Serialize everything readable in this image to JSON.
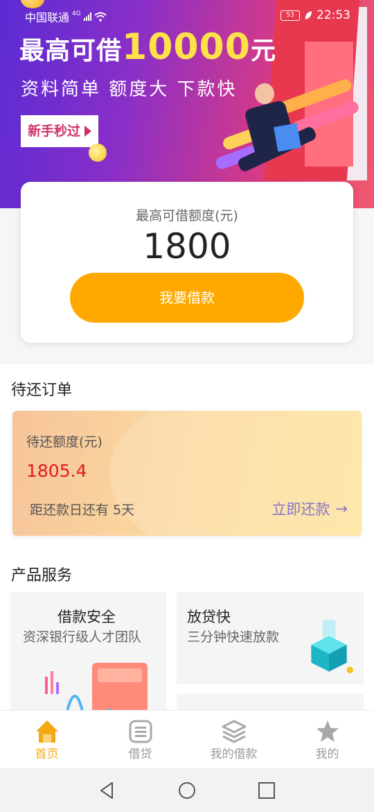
{
  "status_bar": {
    "carrier": "中国联通",
    "network": "4G",
    "battery": "53",
    "time": "22:53"
  },
  "banner": {
    "headline_prefix": "最高可借",
    "headline_amount": "10000",
    "headline_suffix": "元",
    "subtitle": "资料简单 额度大 下款快",
    "cta_label": "新手秒过"
  },
  "loan_card": {
    "label": "最高可借额度(元)",
    "amount": "1800",
    "button_label": "我要借款"
  },
  "pending_section": {
    "title": "待还订单",
    "card": {
      "label": "待还额度(元)",
      "amount": "1805.4",
      "due_text": "距还款日还有 5天",
      "repay_label": "立即还款"
    }
  },
  "products_section": {
    "title": "产品服务",
    "items": [
      {
        "title": "借款安全",
        "desc": "资深银行级人才团队"
      },
      {
        "title": "放贷快",
        "desc": "三分钟快速放款"
      }
    ]
  },
  "tabbar": {
    "items": [
      {
        "label": "首页",
        "icon": "home-icon",
        "active": true
      },
      {
        "label": "借贷",
        "icon": "list-icon",
        "active": false
      },
      {
        "label": "我的借款",
        "icon": "layers-icon",
        "active": false
      },
      {
        "label": "我的",
        "icon": "star-icon",
        "active": false
      }
    ]
  },
  "colors": {
    "accent": "#ffa900",
    "tab_active": "#f5a915",
    "amount_red": "#e21b1b",
    "repay_purple": "#8a72c8"
  }
}
